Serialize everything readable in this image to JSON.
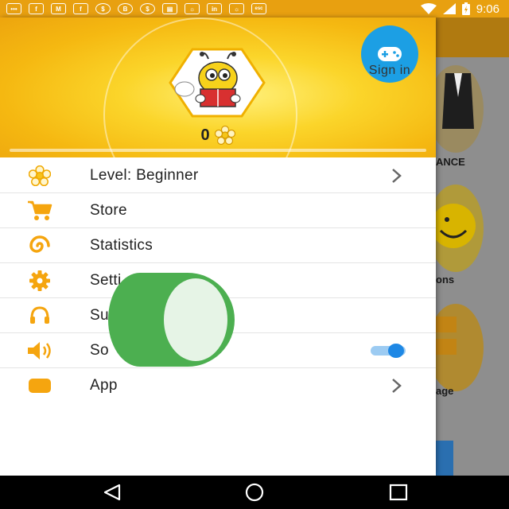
{
  "status_bar": {
    "time": "9:06",
    "notification_icons": [
      "message-icon",
      "facebook-icon",
      "gmail-icon",
      "facebook-icon",
      "money-bag-icon",
      "bitcoin-icon",
      "money-bag-icon",
      "sim-card-icon",
      "game-icon",
      "linkedin-icon",
      "game-icon",
      "esc-icon"
    ],
    "color": "#e8a010"
  },
  "drawer": {
    "header": {
      "signin_label": "Sign in",
      "coin_count": "0",
      "progress": 0.0
    },
    "menu": [
      {
        "label": "Level: Beginner",
        "icon": "flower-icon",
        "trailing": "chevron"
      },
      {
        "label": "Store",
        "icon": "cart-icon",
        "trailing": ""
      },
      {
        "label": "Statistics",
        "icon": "spiral-icon",
        "trailing": ""
      },
      {
        "label": "Setti",
        "icon": "gear-icon",
        "trailing": ""
      },
      {
        "label": "Su",
        "icon": "headphones-icon",
        "trailing": ""
      },
      {
        "label": "So",
        "icon": "speaker-icon",
        "trailing": "toggle",
        "toggle_on": true
      },
      {
        "label": "App",
        "icon": "app-icon",
        "trailing": "chevron"
      }
    ]
  },
  "background_app": {
    "labels": [
      "ANCE",
      "ons",
      "age"
    ]
  },
  "colors": {
    "accent_orange": "#f5a50f",
    "toggle_blue": "#1e88e5",
    "signin_blue": "#1c9fe4",
    "overlay_green": "#4caf50"
  }
}
